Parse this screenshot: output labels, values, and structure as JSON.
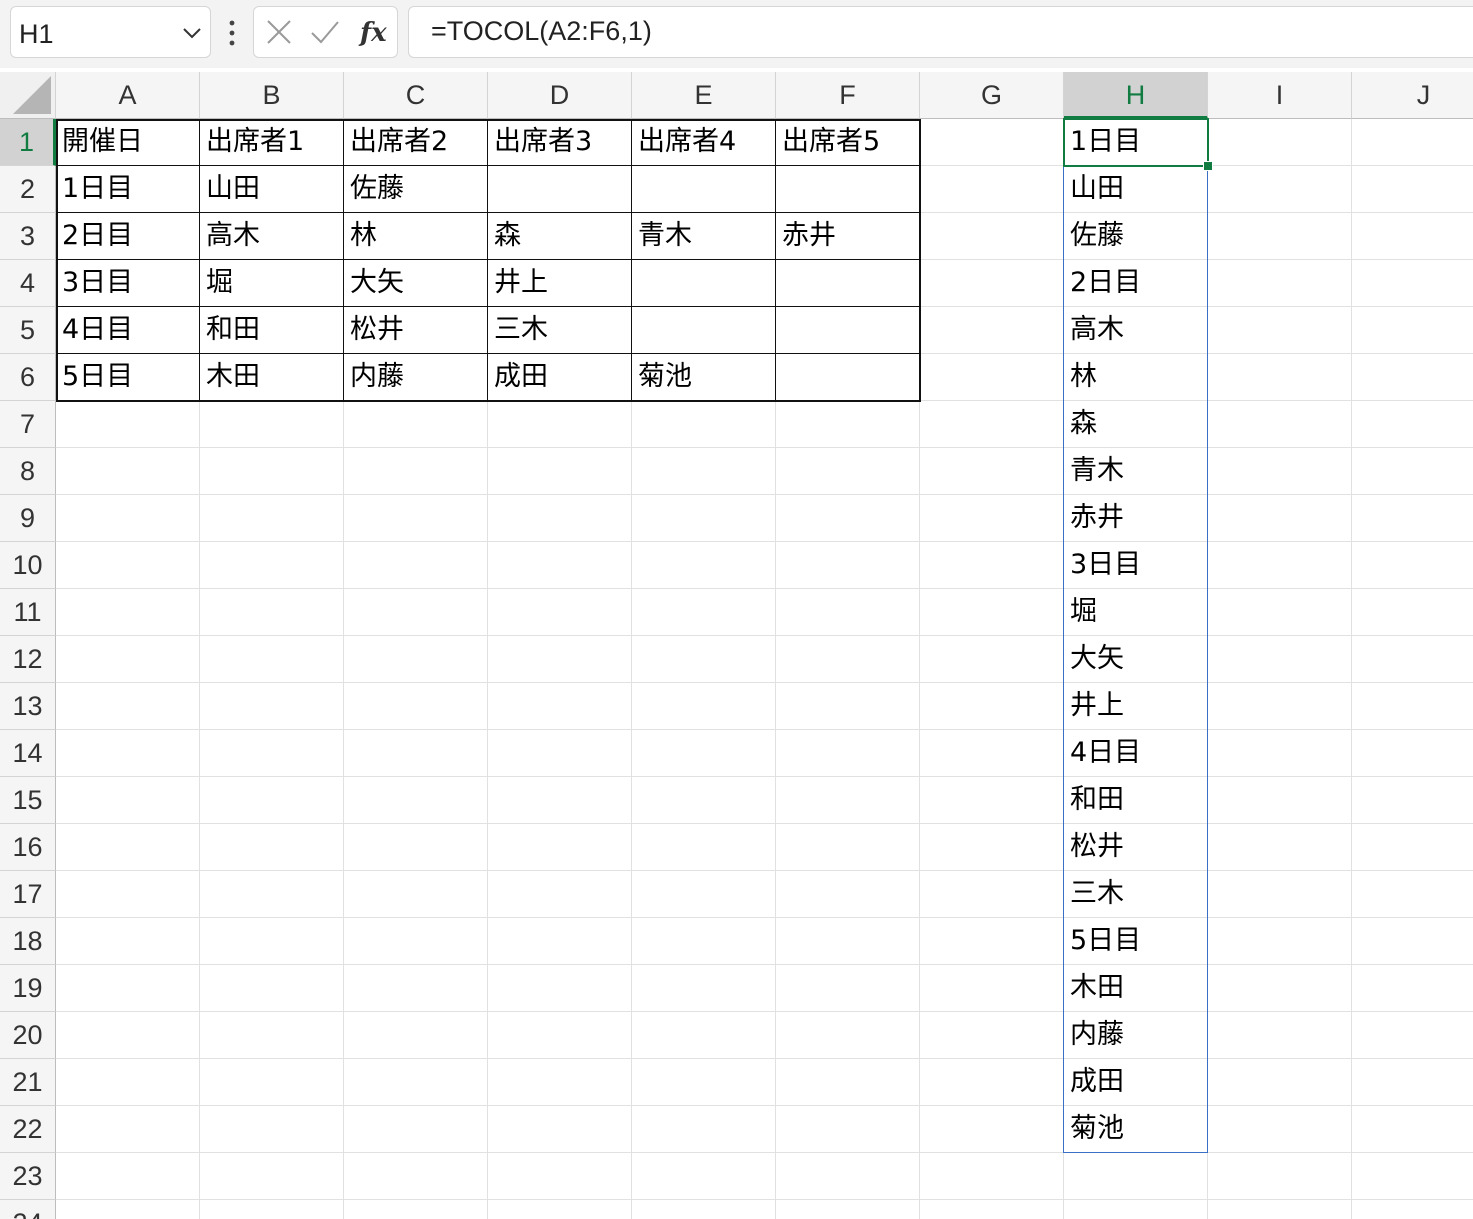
{
  "name_box": {
    "value": "H1"
  },
  "formula_bar": {
    "formula": "=TOCOL(A2:F6,1)"
  },
  "icons": {
    "cancel": "close-icon",
    "enter": "check-icon",
    "function": "fx-icon",
    "more": "kebab-icon",
    "dropdown": "chevron-down-icon"
  },
  "columns": [
    "A",
    "B",
    "C",
    "D",
    "E",
    "F",
    "G",
    "H",
    "I",
    "J"
  ],
  "selected_column": "H",
  "rows": [
    "1",
    "2",
    "3",
    "4",
    "5",
    "6",
    "7",
    "8",
    "9",
    "10",
    "11",
    "12",
    "13",
    "14",
    "15",
    "16",
    "17",
    "18",
    "19",
    "20",
    "21",
    "22",
    "23",
    "24"
  ],
  "selected_row": "1",
  "table": [
    [
      "開催日",
      "出席者1",
      "出席者2",
      "出席者3",
      "出席者4",
      "出席者5"
    ],
    [
      "1日目",
      "山田",
      "佐藤",
      "",
      "",
      ""
    ],
    [
      "2日目",
      "高木",
      "林",
      "森",
      "青木",
      "赤井"
    ],
    [
      "3日目",
      "堀",
      "大矢",
      "井上",
      "",
      ""
    ],
    [
      "4日目",
      "和田",
      "松井",
      "三木",
      "",
      ""
    ],
    [
      "5日目",
      "木田",
      "内藤",
      "成田",
      "菊池",
      ""
    ]
  ],
  "spill_result": [
    "1日目",
    "山田",
    "佐藤",
    "2日目",
    "高木",
    "林",
    "森",
    "青木",
    "赤井",
    "3日目",
    "堀",
    "大矢",
    "井上",
    "4日目",
    "和田",
    "松井",
    "三木",
    "5日目",
    "木田",
    "内藤",
    "成田",
    "菊池"
  ],
  "colors": {
    "selection": "#107c41",
    "spill_border": "#3a6fc4",
    "header_bg": "#f5f5f5",
    "grid": "#e1e1e1"
  }
}
